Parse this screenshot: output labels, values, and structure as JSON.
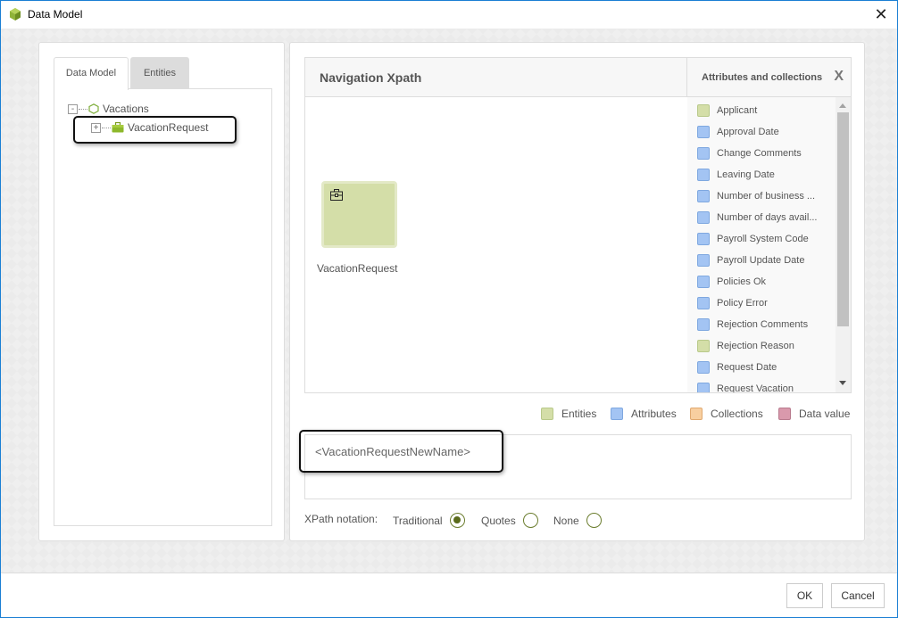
{
  "window": {
    "title": "Data Model",
    "app_icon": "cube-icon",
    "close_icon": "close-icon"
  },
  "left_panel": {
    "tabs": [
      {
        "label": "Data Model",
        "active": true
      },
      {
        "label": "Entities",
        "active": false
      }
    ],
    "tree": {
      "root": {
        "label": "Vacations",
        "toggle": "-",
        "icon": "hexagon-icon",
        "expanded": true
      },
      "children": [
        {
          "label": "VacationRequest",
          "toggle": "+",
          "icon": "briefcase-icon",
          "expanded": false,
          "highlighted": true
        }
      ]
    }
  },
  "navigation": {
    "title": "Navigation Xpath",
    "entity_card": {
      "label": "VacationRequest",
      "icon": "briefcase-icon"
    }
  },
  "attributes_panel": {
    "title": "Attributes and collections",
    "close_label": "X",
    "items": [
      {
        "label": "Applicant",
        "type": "entity"
      },
      {
        "label": "Approval Date",
        "type": "attribute"
      },
      {
        "label": "Change Comments",
        "type": "attribute"
      },
      {
        "label": "Leaving Date",
        "type": "attribute"
      },
      {
        "label": "Number of business ...",
        "type": "attribute"
      },
      {
        "label": "Number of days avail...",
        "type": "attribute"
      },
      {
        "label": "Payroll System Code",
        "type": "attribute"
      },
      {
        "label": "Payroll Update Date",
        "type": "attribute"
      },
      {
        "label": "Policies Ok",
        "type": "attribute"
      },
      {
        "label": "Policy Error",
        "type": "attribute"
      },
      {
        "label": "Rejection Comments",
        "type": "attribute"
      },
      {
        "label": "Rejection Reason",
        "type": "entity"
      },
      {
        "label": "Request Date",
        "type": "attribute"
      },
      {
        "label": "Request Vacation",
        "type": "attribute"
      }
    ]
  },
  "legend": [
    {
      "label": "Entities",
      "color": "#d4dea8"
    },
    {
      "label": "Attributes",
      "color": "#a3c4f3"
    },
    {
      "label": "Collections",
      "color": "#f8cfa0"
    },
    {
      "label": "Data value",
      "color": "#d999ac"
    }
  ],
  "xpath": {
    "value": "<VacationRequestNewName>"
  },
  "notation": {
    "label": "XPath notation:",
    "options": [
      {
        "label": "Traditional",
        "checked": true
      },
      {
        "label": "Quotes",
        "checked": false
      },
      {
        "label": "None",
        "checked": false
      }
    ]
  },
  "footer": {
    "ok_label": "OK",
    "cancel_label": "Cancel"
  }
}
